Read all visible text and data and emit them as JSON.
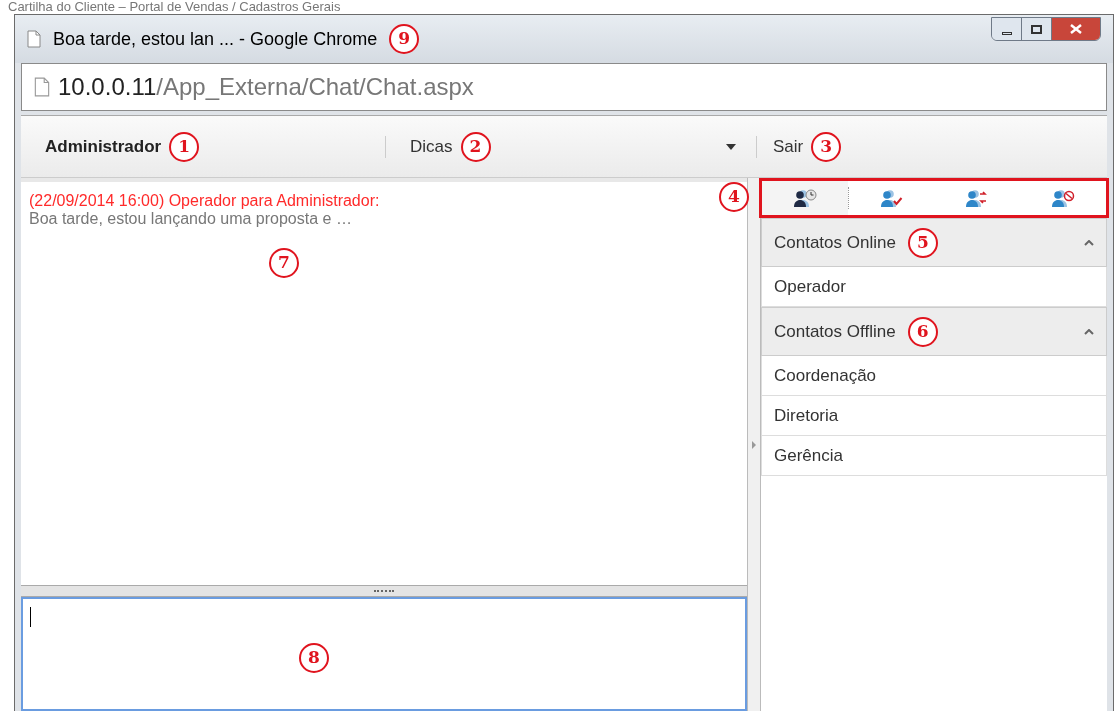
{
  "page_title": "Cartilha do Cliente – Portal de Vendas / Cadastros Gerais",
  "window": {
    "title": "Boa tarde, estou lan ... - Google Chrome"
  },
  "address": {
    "host": "10.0.0.11",
    "path": "/App_Externa/Chat/Chat.aspx"
  },
  "header": {
    "user": "Administrador",
    "menu": "Dicas",
    "logout": "Sair"
  },
  "status_buttons": [
    {
      "kind": "away",
      "selected": true
    },
    {
      "kind": "available",
      "selected": false
    },
    {
      "kind": "busy",
      "selected": false
    },
    {
      "kind": "offline",
      "selected": false
    }
  ],
  "messages": [
    {
      "meta": "(22/09/2014 16:00) Operador para Administrador:",
      "text": "Boa tarde, estou lançando uma proposta e …"
    }
  ],
  "groups": [
    {
      "title": "Contatos Online",
      "expanded": true,
      "contacts": [
        "Operador"
      ]
    },
    {
      "title": "Contatos Offline",
      "expanded": true,
      "contacts": [
        "Coordenação",
        "Diretoria",
        "Gerência"
      ]
    }
  ],
  "callouts": {
    "user": "1",
    "menu": "2",
    "logout": "3",
    "toolbar": "4",
    "online": "5",
    "offline": "6",
    "messages": "7",
    "input": "8",
    "title": "9"
  }
}
